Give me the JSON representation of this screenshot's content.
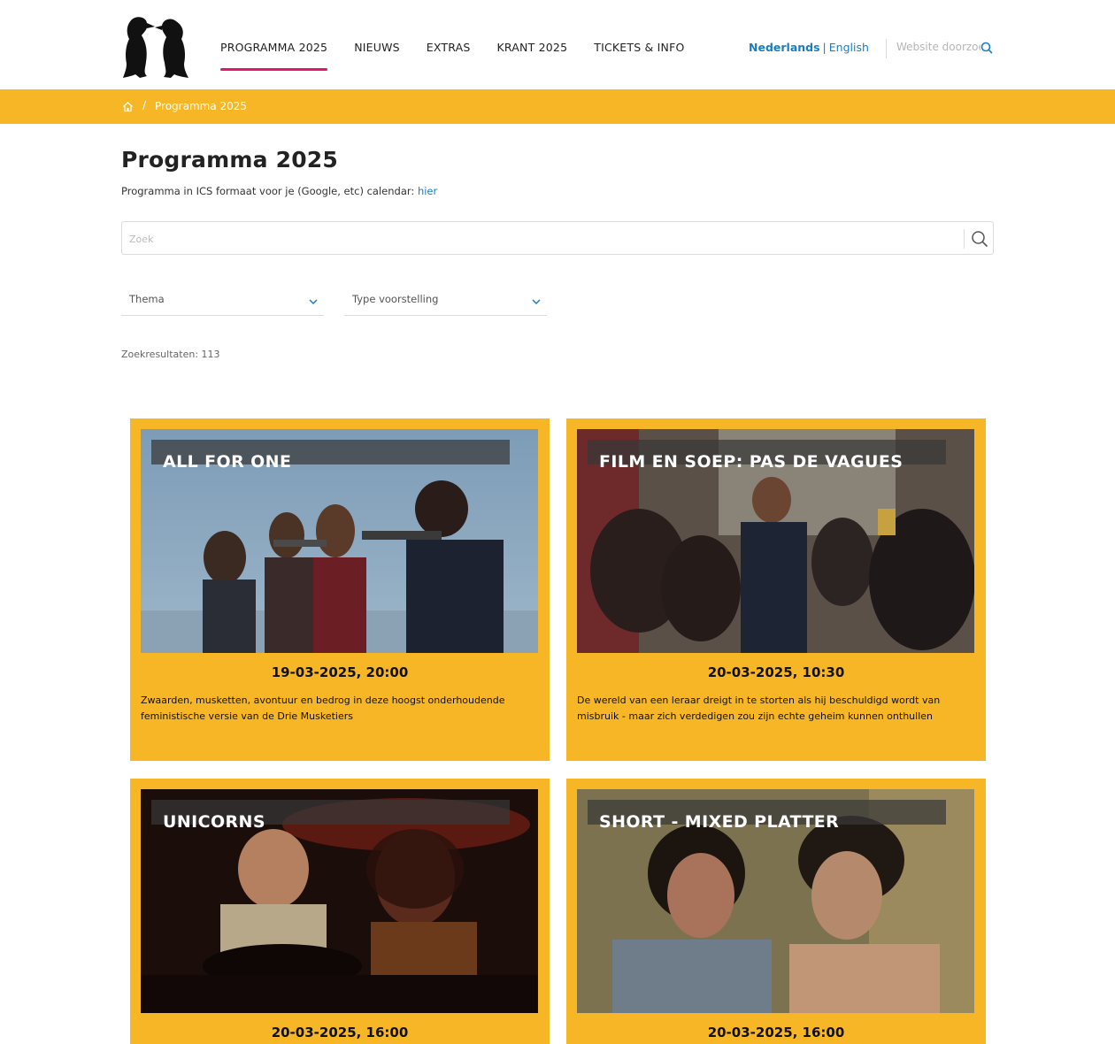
{
  "header": {
    "nav": [
      {
        "label": "PROGRAMMA 2025",
        "active": true
      },
      {
        "label": "NIEUWS",
        "active": false
      },
      {
        "label": "EXTRAS",
        "active": false
      },
      {
        "label": "KRANT 2025",
        "active": false
      },
      {
        "label": "TICKETS & INFO",
        "active": false
      }
    ],
    "lang": {
      "nl": "Nederlands",
      "sep": "|",
      "en": "English"
    },
    "site_search_placeholder": "Website doorzoeken",
    "icons": {
      "logo": "penguins-logo",
      "search": "search-icon"
    }
  },
  "breadcrumb": {
    "sep": "/",
    "current": "Programma 2025"
  },
  "page": {
    "title": "Programma 2025",
    "ics_text": "Programma in ICS formaat voor je (Google, etc) calendar: ",
    "ics_link": "hier",
    "search_placeholder": "Zoek",
    "filters": {
      "theme": "Thema",
      "type": "Type voorstelling"
    },
    "result_count": "Zoekresultaten: 113"
  },
  "cards": [
    {
      "title": "ALL FOR ONE",
      "date": "19-03-2025, 20:00",
      "desc": "Zwaarden, musketten, avontuur en bedrog in deze hoogst onderhoudende feministische versie van de Drie Musketiers"
    },
    {
      "title": "FILM EN SOEP: PAS DE VAGUES",
      "date": "20-03-2025, 10:30",
      "desc": "De wereld van een leraar dreigt in te storten als hij beschuldigd wordt van misbruik - maar zich verdedigen zou zijn echte geheim kunnen onthullen"
    },
    {
      "title": "UNICORNS",
      "date": "20-03-2025, 16:00",
      "desc": ""
    },
    {
      "title": "SHORT - MIXED PLATTER",
      "date": "20-03-2025, 16:00",
      "desc": ""
    }
  ],
  "colors": {
    "accent_yellow": "#f6b626",
    "nav_active": "#e5146f",
    "link_blue": "#1a7dc0"
  }
}
